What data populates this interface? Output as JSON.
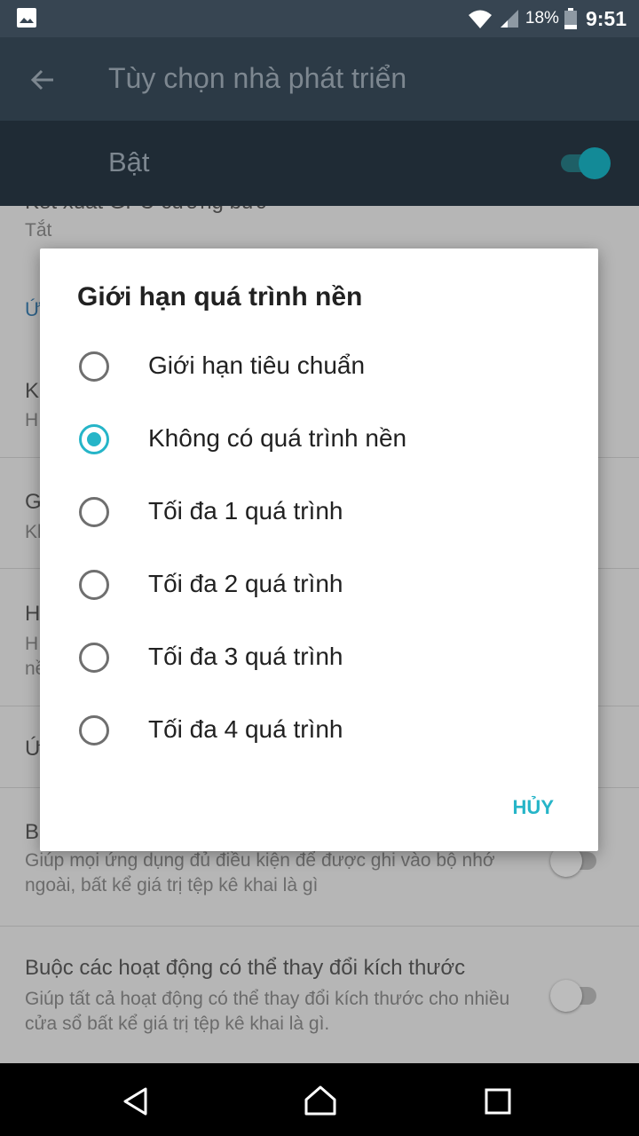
{
  "status_bar": {
    "battery_pct": "18%",
    "time": "9:51",
    "icons": [
      "image-notification-icon",
      "wifi-icon",
      "cell-signal-icon",
      "battery-icon"
    ]
  },
  "app_bar": {
    "title": "Tùy chọn nhà phát triển",
    "back_icon": "back-arrow-icon"
  },
  "master_switch": {
    "label": "Bật",
    "state": "on"
  },
  "background_list": {
    "rows": [
      {
        "title": "Kết xuất GPU cưỡng bức",
        "summary": "Tắt"
      },
      {
        "title": "Ứ",
        "summary": ""
      },
      {
        "title": "K",
        "summary": "H"
      },
      {
        "title": "G",
        "summary": "Kl"
      },
      {
        "title": "H",
        "summary": "H"
      },
      {
        "title": "nề",
        "summary": ""
      },
      {
        "title": "Ứ",
        "summary": ""
      },
      {
        "title": "B",
        "summary": ""
      },
      {
        "title": "",
        "summary": "Giúp mọi ứng dụng đủ điều kiện để được ghi vào bộ nhớ ngoài, bất kể giá trị tệp kê khai là gì"
      },
      {
        "title": "Buộc các hoạt động có thể thay đổi kích thước",
        "summary": "Giúp tất cả hoạt động có thể thay đổi kích thước cho nhiều cửa sổ bất kể giá trị tệp kê khai là gì."
      }
    ]
  },
  "dialog": {
    "title": "Giới hạn quá trình nền",
    "options": [
      {
        "label": "Giới hạn tiêu chuẩn",
        "selected": false
      },
      {
        "label": "Không có quá trình nền",
        "selected": true
      },
      {
        "label": "Tối đa 1 quá trình",
        "selected": false
      },
      {
        "label": "Tối đa 2 quá trình",
        "selected": false
      },
      {
        "label": "Tối đa 3 quá trình",
        "selected": false
      },
      {
        "label": "Tối đa 4 quá trình",
        "selected": false
      }
    ],
    "cancel_label": "HỦY"
  },
  "nav_bar": {
    "icons": [
      "nav-back-icon",
      "nav-home-icon",
      "nav-recents-icon"
    ]
  },
  "colors": {
    "accent": "#26b5c8",
    "appbar": "#2c3a46",
    "statusbar": "#374552"
  }
}
